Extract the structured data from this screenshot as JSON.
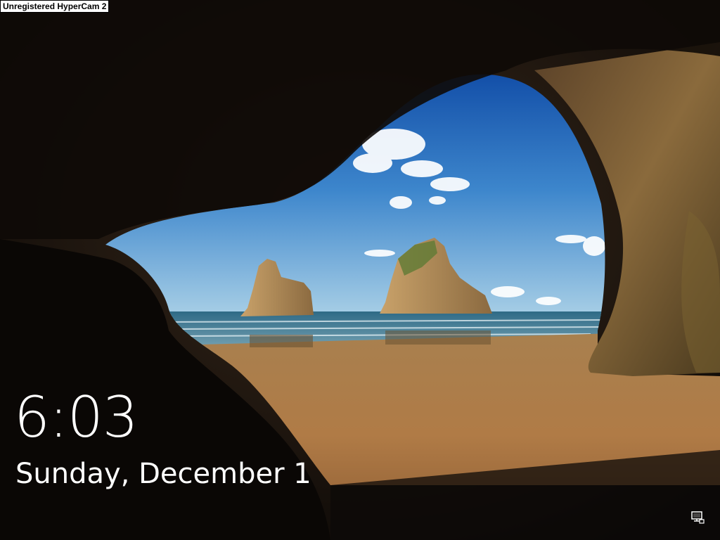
{
  "watermark": {
    "text": "Unregistered HyperCam 2"
  },
  "lock_screen": {
    "time": "6:03",
    "date": "Sunday, December 1"
  },
  "status_icons": {
    "network": "network-icon"
  },
  "colors": {
    "text": "#ffffff",
    "sky_top": "#1e5fb0",
    "sky_bottom": "#9cc7e4",
    "sand": "#b07a45"
  }
}
